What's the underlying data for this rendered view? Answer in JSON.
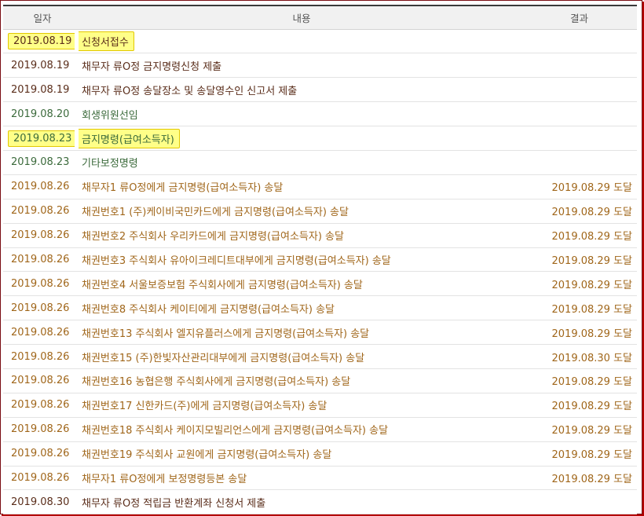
{
  "headers": {
    "date": "일자",
    "content": "내용",
    "result": "결과"
  },
  "colors": {
    "dark": "#5a2d1a",
    "green": "#3b6a3b",
    "orange": "#a0661a",
    "highlight": "#ffff88"
  },
  "rows": [
    {
      "date": "2019.08.19",
      "content": "신청서접수",
      "result": "",
      "tone": "dark",
      "highlighted": true
    },
    {
      "date": "2019.08.19",
      "content": "채무자 류O정 금지명령신청 제출",
      "result": "",
      "tone": "dark",
      "highlighted": false
    },
    {
      "date": "2019.08.19",
      "content": "채무자 류O정 송달장소 및 송달영수인 신고서 제출",
      "result": "",
      "tone": "dark",
      "highlighted": false
    },
    {
      "date": "2019.08.20",
      "content": "회생위원선임",
      "result": "",
      "tone": "green",
      "highlighted": false
    },
    {
      "date": "2019.08.23",
      "content": "금지명령(급여소득자)",
      "result": "",
      "tone": "green",
      "highlighted": true
    },
    {
      "date": "2019.08.23",
      "content": "기타보정명령",
      "result": "",
      "tone": "green",
      "highlighted": false
    },
    {
      "date": "2019.08.26",
      "content": "채무자1 류O정에게 금지명령(급여소득자) 송달",
      "result": "2019.08.29 도달",
      "tone": "orange",
      "highlighted": false
    },
    {
      "date": "2019.08.26",
      "content": "채권번호1 (주)케이비국민카드에게 금지명령(급여소득자) 송달",
      "result": "2019.08.29 도달",
      "tone": "orange",
      "highlighted": false
    },
    {
      "date": "2019.08.26",
      "content": "채권번호2 주식회사 우리카드에게 금지명령(급여소득자) 송달",
      "result": "2019.08.29 도달",
      "tone": "orange",
      "highlighted": false
    },
    {
      "date": "2019.08.26",
      "content": "채권번호3 주식회사 유아이크레디트대부에게 금지명령(급여소득자) 송달",
      "result": "2019.08.29 도달",
      "tone": "orange",
      "highlighted": false
    },
    {
      "date": "2019.08.26",
      "content": "채권번호4 서울보증보험 주식회사에게 금지명령(급여소득자) 송달",
      "result": "2019.08.29 도달",
      "tone": "orange",
      "highlighted": false
    },
    {
      "date": "2019.08.26",
      "content": "채권번호8 주식회사 케이티에게 금지명령(급여소득자) 송달",
      "result": "2019.08.29 도달",
      "tone": "orange",
      "highlighted": false
    },
    {
      "date": "2019.08.26",
      "content": "채권번호13 주식회사 엘지유플러스에게 금지명령(급여소득자) 송달",
      "result": "2019.08.29 도달",
      "tone": "orange",
      "highlighted": false
    },
    {
      "date": "2019.08.26",
      "content": "채권번호15 (주)한빛자산관리대부에게 금지명령(급여소득자) 송달",
      "result": "2019.08.30 도달",
      "tone": "orange",
      "highlighted": false
    },
    {
      "date": "2019.08.26",
      "content": "채권번호16 농협은행 주식회사에게 금지명령(급여소득자) 송달",
      "result": "2019.08.29 도달",
      "tone": "orange",
      "highlighted": false
    },
    {
      "date": "2019.08.26",
      "content": "채권번호17 신한카드(주)에게 금지명령(급여소득자) 송달",
      "result": "2019.08.29 도달",
      "tone": "orange",
      "highlighted": false
    },
    {
      "date": "2019.08.26",
      "content": "채권번호18 주식회사 케이지모빌리언스에게 금지명령(급여소득자) 송달",
      "result": "2019.08.29 도달",
      "tone": "orange",
      "highlighted": false
    },
    {
      "date": "2019.08.26",
      "content": "채권번호19 주식회사 교원에게 금지명령(급여소득자) 송달",
      "result": "2019.08.29 도달",
      "tone": "orange",
      "highlighted": false
    },
    {
      "date": "2019.08.26",
      "content": "채무자1 류O정에게 보정명령등본 송달",
      "result": "2019.08.29 도달",
      "tone": "orange",
      "highlighted": false
    },
    {
      "date": "2019.08.30",
      "content": "채무자 류O정 적립금 반환계좌 신청서 제출",
      "result": "",
      "tone": "dark",
      "highlighted": false
    }
  ]
}
